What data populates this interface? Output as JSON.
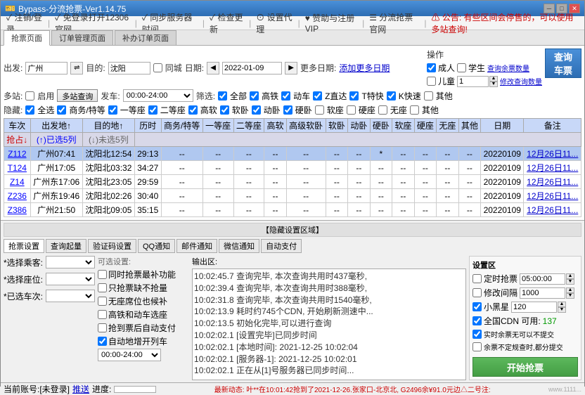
{
  "titleBar": {
    "title": "Bypass-分流抢票-Ver1.14.75",
    "icon": "🎫",
    "controls": [
      "─",
      "□",
      "✕"
    ]
  },
  "menuBar": {
    "items": [
      {
        "label": "✓ 注销/登录",
        "checked": true
      },
      {
        "label": "✓ 免登录打开12306官网",
        "checked": true
      },
      {
        "label": "✓ 同步服务器时间",
        "checked": true
      },
      {
        "label": "✓ 检查更新",
        "checked": true
      },
      {
        "label": "⊙ 设置代理",
        "checked": false
      },
      {
        "label": "♥ 赞助与注册VIP",
        "checked": false
      },
      {
        "label": "☰ 分流抢票官网",
        "checked": false
      },
      {
        "label": "⚠ 公告: 有些区间会停售的，可以使用多站查询!",
        "checked": false
      }
    ]
  },
  "tabs": {
    "main": [
      "抢票页面",
      "订单管理页面",
      "补办订单页面"
    ],
    "activeTab": 0
  },
  "searchForm": {
    "fromLabel": "出发:",
    "fromValue": "广州",
    "toLabel": "目的:",
    "toValue": "沈阳",
    "sameCityLabel": "同城",
    "dateLabel": "日期:",
    "dateValue": "2022-01-09",
    "moreDatesLabel": "添加更多日期",
    "multiStationLabel": "多站:",
    "multiStationEnabled": false,
    "multiStationBtn": "多站查询",
    "departLabel": "发车:",
    "departFrom": "00:00",
    "departTo": "24:00",
    "filterLabel": "筛选:",
    "filterOptions": [
      {
        "label": "全部",
        "checked": true
      },
      {
        "label": "高铁",
        "checked": true
      },
      {
        "label": "动车",
        "checked": true
      },
      {
        "label": "Z直达",
        "checked": true
      },
      {
        "label": "T特快",
        "checked": true
      },
      {
        "label": "K快速",
        "checked": true
      },
      {
        "label": "其他",
        "checked": false
      }
    ],
    "hideLabel": "隐藏:",
    "hideOptions": [
      {
        "label": "全选",
        "checked": true
      },
      {
        "label": "商务/特等",
        "checked": true
      },
      {
        "label": "一等座",
        "checked": true
      },
      {
        "label": "二等座",
        "checked": true
      },
      {
        "label": "高软",
        "checked": true
      },
      {
        "label": "软卧",
        "checked": true
      },
      {
        "label": "动卧",
        "checked": true
      },
      {
        "label": "硬卧",
        "checked": true
      },
      {
        "label": "软座",
        "checked": false
      },
      {
        "label": "硬座",
        "checked": false
      },
      {
        "label": "无座",
        "checked": false
      },
      {
        "label": "其他",
        "checked": false
      }
    ]
  },
  "operations": {
    "title": "操作",
    "passengerOptions": [
      {
        "label": "成人",
        "checked": true
      },
      {
        "label": "学生",
        "checked": false
      }
    ],
    "childLabel": "儿童",
    "childValue": "1",
    "queryLinkLabel": "查询余票数量",
    "queryLinkLabel2": "修改查询数量",
    "queryBtnLabel": "查询\n车票"
  },
  "tableHeaders": {
    "row1": [
      "车次",
      "出发地↑",
      "目的地↑",
      "历时",
      "商务/特等",
      "一等座",
      "二等座",
      "高软",
      "高级软卧",
      "软卧",
      "动卧",
      "硬卧",
      "软座",
      "硬座",
      "无座",
      "其他",
      "日期",
      "备注"
    ],
    "row2": [
      "抢占↓",
      "(↑)已选5列",
      "(↓)未选5列",
      "",
      "",
      "",
      "",
      "",
      "",
      "",
      "",
      "",
      "",
      "",
      "",
      "",
      "",
      ""
    ]
  },
  "tableRows": [
    {
      "train": "Z112",
      "from": "广州07:41",
      "to": "沈阳北12:54",
      "duration": "29:13",
      "s1": "--",
      "s2": "--",
      "s3": "--",
      "s4": "--",
      "s5": "--",
      "s6": "--",
      "s7": "--",
      "s8": "*",
      "s9": "--",
      "s10": "--",
      "s11": "--",
      "s12": "--",
      "date": "20220109",
      "note": "12月26日11...",
      "selected": true
    },
    {
      "train": "T124",
      "from": "广州17:05",
      "to": "沈阳北03:32",
      "duration": "34:27",
      "s1": "--",
      "s2": "--",
      "s3": "--",
      "s4": "--",
      "s5": "--",
      "s6": "--",
      "s7": "--",
      "s8": "--",
      "s9": "--",
      "s10": "--",
      "s11": "--",
      "s12": "--",
      "date": "20220109",
      "note": "12月26日11...",
      "selected": false
    },
    {
      "train": "Z14",
      "from": "广州东17:06",
      "to": "沈阳北23:05",
      "duration": "29:59",
      "s1": "--",
      "s2": "--",
      "s3": "--",
      "s4": "--",
      "s5": "--",
      "s6": "--",
      "s7": "--",
      "s8": "--",
      "s9": "--",
      "s10": "--",
      "s11": "--",
      "s12": "--",
      "date": "20220109",
      "note": "12月26日11...",
      "selected": false
    },
    {
      "train": "Z236",
      "from": "广州东19:46",
      "to": "沈阳北02:26",
      "duration": "30:40",
      "s1": "--",
      "s2": "--",
      "s3": "--",
      "s4": "--",
      "s5": "--",
      "s6": "--",
      "s7": "--",
      "s8": "--",
      "s9": "--",
      "s10": "--",
      "s11": "--",
      "s12": "--",
      "date": "20220109",
      "note": "12月26日11...",
      "selected": false
    },
    {
      "train": "Z386",
      "from": "广州21:50",
      "to": "沈阳北09:05",
      "duration": "35:15",
      "s1": "--",
      "s2": "--",
      "s3": "--",
      "s4": "--",
      "s5": "--",
      "s6": "--",
      "s7": "--",
      "s8": "--",
      "s9": "--",
      "s10": "--",
      "s11": "--",
      "s12": "--",
      "date": "20220109",
      "note": "12月26日11...",
      "selected": false
    }
  ],
  "hiddenRegion": {
    "label": "【隐藏设置区域】"
  },
  "bottomTabs": {
    "tabs": [
      "抢票设置",
      "查询起量",
      "验证码设置",
      "QQ通知",
      "邮件通知",
      "微信通知",
      "自动支付"
    ],
    "activeTab": 0
  },
  "grabSettings": {
    "passengerLabel": "*选择乘客:",
    "seatLabel": "*选择座位:",
    "countLabel": "*已选车次:",
    "options": [
      {
        "label": "同时抢票最补功能",
        "checked": false
      },
      {
        "label": "只抢票缺不抢量",
        "checked": false
      },
      {
        "label": "无座席位也候补",
        "checked": false
      },
      {
        "label": "高铁和动车选座",
        "checked": false
      },
      {
        "label": "抢到票后自动支付",
        "checked": false
      },
      {
        "label": "自动地增开列车",
        "checked": true
      }
    ],
    "timeRange": "00:00-24:00"
  },
  "outputArea": {
    "title": "输出区:",
    "lines": [
      "10:02:45.7  查询完毕, 本次查询共用时437毫秒,",
      "10:02:39.4  查询完毕, 本次查询共用时388毫秒,",
      "10:02:31.8  查询完毕, 本次查询共用时1540毫秒,",
      "10:02:13.9  耗时约745个CDN, 开始刷新测速中...",
      "10:02:13.5  初始化完毕,可以进行查询",
      "10:02:02.1  [设置完毕]已同步时间",
      "10:02:02.1  [本地时间]: 2021-12-25 10:02:04",
      "10:02:02.1  [服务器-1]: 2021-12-25 10:02:01",
      "10:02:02.1  正在从[1]号服务器已同步时间..."
    ]
  },
  "settingsArea": {
    "title": "设置区",
    "items": [
      {
        "label": "定时抢票",
        "checked": false,
        "value": "05:00:00"
      },
      {
        "label": "修改间隔",
        "checked": false,
        "value": "1000"
      },
      {
        "label": "小黑星",
        "checked": true,
        "value": "120"
      },
      {
        "label": "全国CDN 可用:",
        "checked": true,
        "availCount": "137"
      }
    ],
    "realtimeLabel": "✓ 实时余票无可以不提交",
    "realtimeChecked": true,
    "remainLabel": "□ 余票不定规查时,都分提交",
    "remainChecked": false,
    "startBtnLabel": "开始抢票"
  },
  "statusBar": {
    "accountLabel": "当前账号:[未登录]",
    "pushLabel": "推送",
    "progressLabel": "进度:",
    "mainStatus": "最新动态: 叶**在10:01:42抢到了2021-12-26.张家口-北京北, G2496余¥91.0元边△二号注:",
    "watermark": "www.1111..."
  }
}
